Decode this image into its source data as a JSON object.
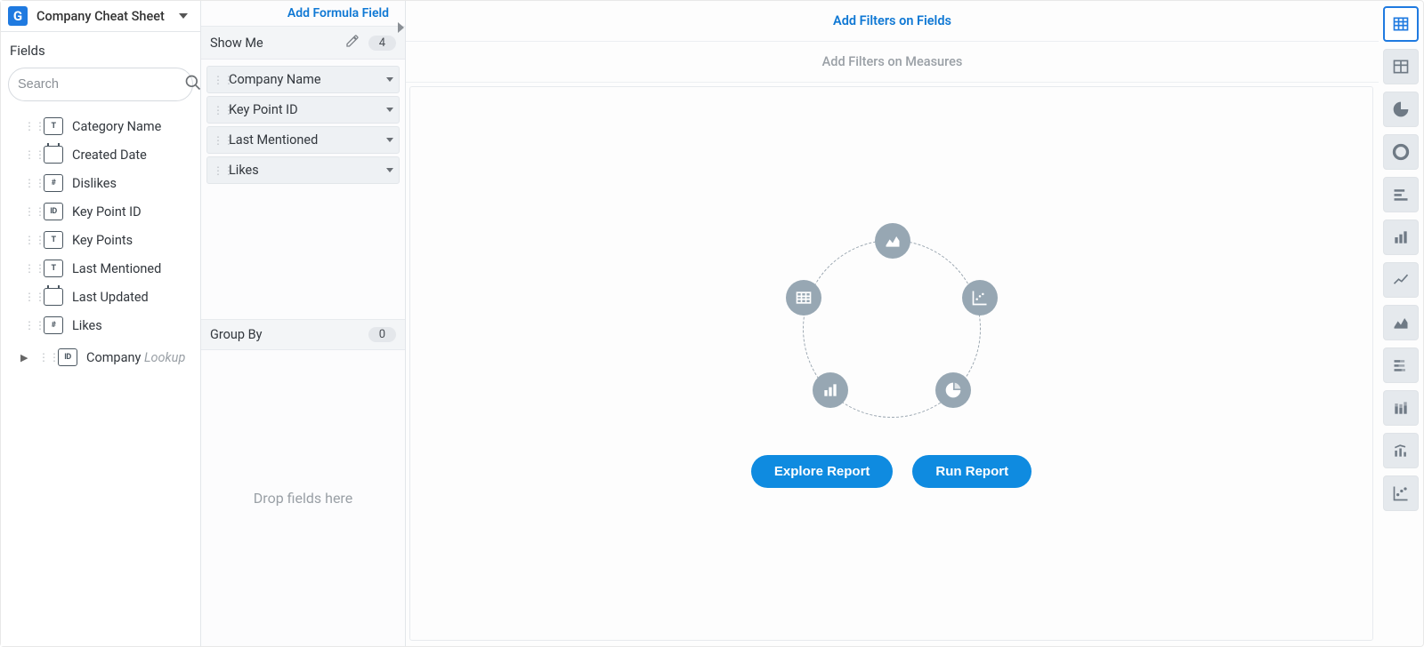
{
  "datasource": {
    "title": "Company Cheat Sheet"
  },
  "fields_label": "Fields",
  "search": {
    "placeholder": "Search"
  },
  "fields": [
    {
      "name": "Category Name",
      "type": "T"
    },
    {
      "name": "Created Date",
      "type": "CAL"
    },
    {
      "name": "Dislikes",
      "type": "#"
    },
    {
      "name": "Key Point ID",
      "type": "ID"
    },
    {
      "name": "Key Points",
      "type": "T"
    },
    {
      "name": "Last Mentioned",
      "type": "T"
    },
    {
      "name": "Last Updated",
      "type": "CAL"
    },
    {
      "name": "Likes",
      "type": "#"
    }
  ],
  "lookup": {
    "name": "Company",
    "suffix": "Lookup"
  },
  "formula": {
    "add_label": "Add Formula Field"
  },
  "show_me": {
    "title": "Show Me",
    "count": "4",
    "items": [
      {
        "label": "Company Name"
      },
      {
        "label": "Key Point ID"
      },
      {
        "label": "Last Mentioned"
      },
      {
        "label": "Likes"
      }
    ]
  },
  "group_by": {
    "title": "Group By",
    "count": "0",
    "drop_hint": "Drop fields here"
  },
  "filters": {
    "fields_label": "Add Filters on Fields",
    "measures_label": "Add Filters on Measures"
  },
  "buttons": {
    "explore": "Explore Report",
    "run": "Run Report"
  },
  "rail": [
    {
      "name": "table-detail",
      "active": true
    },
    {
      "name": "table-summary",
      "active": false
    },
    {
      "name": "pie",
      "active": false
    },
    {
      "name": "donut",
      "active": false
    },
    {
      "name": "hbar",
      "active": false
    },
    {
      "name": "vbar",
      "active": false
    },
    {
      "name": "line",
      "active": false
    },
    {
      "name": "area",
      "active": false
    },
    {
      "name": "stacked-hbar",
      "active": false
    },
    {
      "name": "stacked-vbar",
      "active": false
    },
    {
      "name": "combo",
      "active": false
    },
    {
      "name": "scatter",
      "active": false
    }
  ]
}
